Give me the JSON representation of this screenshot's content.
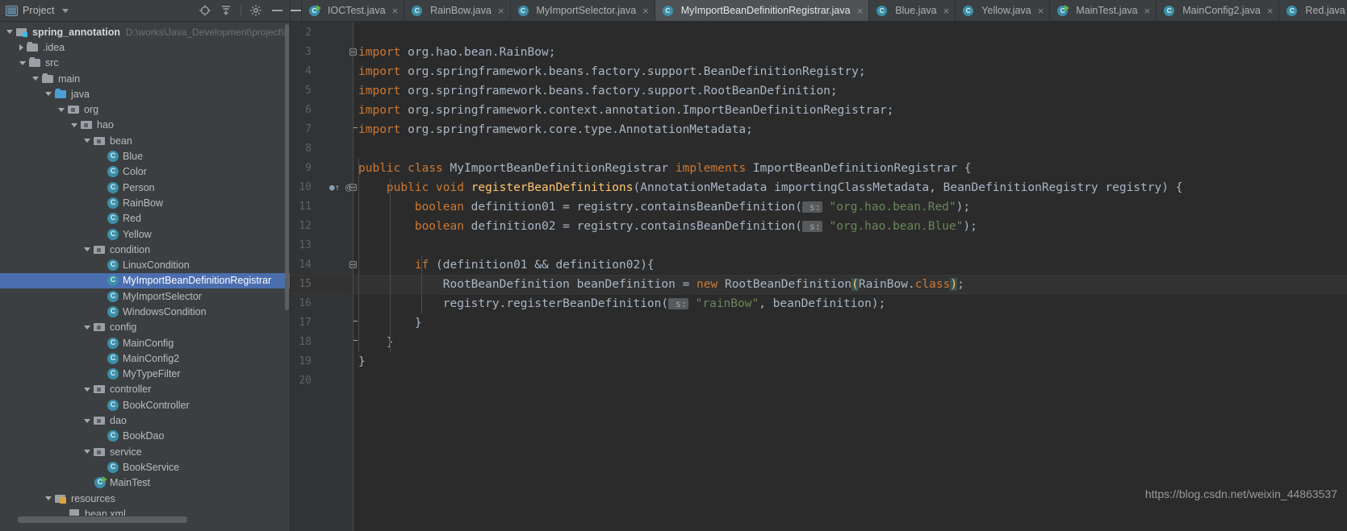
{
  "sidebar": {
    "title": "Project",
    "title_icon": "project-window-icon",
    "caret_icon": "chevron-down-icon",
    "actions": [
      {
        "name": "locate-icon",
        "label": "Select Opened File"
      },
      {
        "name": "collapse-all-icon",
        "label": "Collapse All"
      },
      {
        "name": "gear-icon",
        "label": "Settings"
      },
      {
        "name": "minimize-icon",
        "label": "Hide"
      }
    ],
    "tree": [
      {
        "depth": 0,
        "arrow": "down",
        "icon": "project-folder-icon",
        "label": "spring_annotation",
        "bold": true,
        "path": "D:\\works\\Java_Development\\project\\I",
        "selected": false
      },
      {
        "depth": 1,
        "arrow": "right",
        "icon": "folder-icon",
        "label": ".idea",
        "bold": false,
        "path": "",
        "selected": false
      },
      {
        "depth": 1,
        "arrow": "down",
        "icon": "folder-icon",
        "label": "src",
        "bold": false,
        "path": "",
        "selected": false
      },
      {
        "depth": 2,
        "arrow": "down",
        "icon": "folder-icon",
        "label": "main",
        "bold": false,
        "path": "",
        "selected": false
      },
      {
        "depth": 3,
        "arrow": "down",
        "icon": "source-folder-icon",
        "label": "java",
        "bold": false,
        "path": "",
        "selected": false
      },
      {
        "depth": 4,
        "arrow": "down",
        "icon": "package-icon",
        "label": "org",
        "bold": false,
        "path": "",
        "selected": false
      },
      {
        "depth": 5,
        "arrow": "down",
        "icon": "package-icon",
        "label": "hao",
        "bold": false,
        "path": "",
        "selected": false
      },
      {
        "depth": 6,
        "arrow": "down",
        "icon": "package-icon",
        "label": "bean",
        "bold": false,
        "path": "",
        "selected": false
      },
      {
        "depth": 7,
        "arrow": "none",
        "icon": "class-icon",
        "label": "Blue",
        "bold": false,
        "path": "",
        "selected": false
      },
      {
        "depth": 7,
        "arrow": "none",
        "icon": "class-icon",
        "label": "Color",
        "bold": false,
        "path": "",
        "selected": false
      },
      {
        "depth": 7,
        "arrow": "none",
        "icon": "class-icon",
        "label": "Person",
        "bold": false,
        "path": "",
        "selected": false
      },
      {
        "depth": 7,
        "arrow": "none",
        "icon": "class-icon",
        "label": "RainBow",
        "bold": false,
        "path": "",
        "selected": false
      },
      {
        "depth": 7,
        "arrow": "none",
        "icon": "class-icon",
        "label": "Red",
        "bold": false,
        "path": "",
        "selected": false
      },
      {
        "depth": 7,
        "arrow": "none",
        "icon": "class-icon",
        "label": "Yellow",
        "bold": false,
        "path": "",
        "selected": false
      },
      {
        "depth": 6,
        "arrow": "down",
        "icon": "package-icon",
        "label": "condition",
        "bold": false,
        "path": "",
        "selected": false
      },
      {
        "depth": 7,
        "arrow": "none",
        "icon": "class-icon",
        "label": "LinuxCondition",
        "bold": false,
        "path": "",
        "selected": false
      },
      {
        "depth": 7,
        "arrow": "none",
        "icon": "class-icon",
        "label": "MyImportBeanDefinitionRegistrar",
        "bold": false,
        "path": "",
        "selected": true
      },
      {
        "depth": 7,
        "arrow": "none",
        "icon": "class-icon",
        "label": "MyImportSelector",
        "bold": false,
        "path": "",
        "selected": false
      },
      {
        "depth": 7,
        "arrow": "none",
        "icon": "class-icon",
        "label": "WindowsCondition",
        "bold": false,
        "path": "",
        "selected": false
      },
      {
        "depth": 6,
        "arrow": "down",
        "icon": "package-icon",
        "label": "config",
        "bold": false,
        "path": "",
        "selected": false
      },
      {
        "depth": 7,
        "arrow": "none",
        "icon": "class-icon",
        "label": "MainConfig",
        "bold": false,
        "path": "",
        "selected": false
      },
      {
        "depth": 7,
        "arrow": "none",
        "icon": "class-icon",
        "label": "MainConfig2",
        "bold": false,
        "path": "",
        "selected": false
      },
      {
        "depth": 7,
        "arrow": "none",
        "icon": "class-icon",
        "label": "MyTypeFilter",
        "bold": false,
        "path": "",
        "selected": false
      },
      {
        "depth": 6,
        "arrow": "down",
        "icon": "package-icon",
        "label": "controller",
        "bold": false,
        "path": "",
        "selected": false
      },
      {
        "depth": 7,
        "arrow": "none",
        "icon": "class-icon",
        "label": "BookController",
        "bold": false,
        "path": "",
        "selected": false
      },
      {
        "depth": 6,
        "arrow": "down",
        "icon": "package-icon",
        "label": "dao",
        "bold": false,
        "path": "",
        "selected": false
      },
      {
        "depth": 7,
        "arrow": "none",
        "icon": "class-icon",
        "label": "BookDao",
        "bold": false,
        "path": "",
        "selected": false
      },
      {
        "depth": 6,
        "arrow": "down",
        "icon": "package-icon",
        "label": "service",
        "bold": false,
        "path": "",
        "selected": false
      },
      {
        "depth": 7,
        "arrow": "none",
        "icon": "class-icon",
        "label": "BookService",
        "bold": false,
        "path": "",
        "selected": false
      },
      {
        "depth": 6,
        "arrow": "none",
        "icon": "runnable-class-icon",
        "label": "MainTest",
        "bold": false,
        "path": "",
        "selected": false
      },
      {
        "depth": 3,
        "arrow": "down",
        "icon": "resources-folder-icon",
        "label": "resources",
        "bold": false,
        "path": "",
        "selected": false
      },
      {
        "depth": 4,
        "arrow": "none",
        "icon": "xml-file-icon",
        "label": "bean.xml",
        "bold": false,
        "path": "",
        "selected": false
      }
    ]
  },
  "tabs": {
    "hide_button": "minimize-icon",
    "close_glyph": "×",
    "items": [
      {
        "label": "IOCTest.java",
        "icon": "runnable-class-icon",
        "active": false,
        "closable": true
      },
      {
        "label": "RainBow.java",
        "icon": "class-icon",
        "active": false,
        "closable": true
      },
      {
        "label": "MyImportSelector.java",
        "icon": "class-icon",
        "active": false,
        "closable": true
      },
      {
        "label": "MyImportBeanDefinitionRegistrar.java",
        "icon": "class-icon",
        "active": true,
        "closable": true
      },
      {
        "label": "Blue.java",
        "icon": "class-icon",
        "active": false,
        "closable": true
      },
      {
        "label": "Yellow.java",
        "icon": "class-icon",
        "active": false,
        "closable": true
      },
      {
        "label": "MainTest.java",
        "icon": "runnable-class-icon",
        "active": false,
        "closable": true
      },
      {
        "label": "MainConfig2.java",
        "icon": "class-icon",
        "active": false,
        "closable": true
      },
      {
        "label": "Red.java",
        "icon": "class-icon",
        "active": false,
        "closable": true
      }
    ]
  },
  "editor": {
    "first_line_number": 2,
    "current_line": 15,
    "gutter_marks": {
      "line10": "●↑ @"
    },
    "lines": [
      {
        "n": 2,
        "segments": [
          {
            "t": "",
            "c": "txt"
          }
        ]
      },
      {
        "n": 3,
        "fold": "start",
        "segments": [
          {
            "t": "import",
            "c": "kw"
          },
          {
            "t": " org.hao.bean.RainBow;",
            "c": "txt"
          }
        ]
      },
      {
        "n": 4,
        "segments": [
          {
            "t": "import",
            "c": "kw"
          },
          {
            "t": " org.springframework.beans.factory.support.BeanDefinitionRegistry;",
            "c": "txt"
          }
        ]
      },
      {
        "n": 5,
        "segments": [
          {
            "t": "import",
            "c": "kw"
          },
          {
            "t": " org.springframework.beans.factory.support.RootBeanDefinition;",
            "c": "txt"
          }
        ]
      },
      {
        "n": 6,
        "segments": [
          {
            "t": "import",
            "c": "kw"
          },
          {
            "t": " org.springframework.context.annotation.ImportBeanDefinitionRegistrar;",
            "c": "txt"
          }
        ]
      },
      {
        "n": 7,
        "fold": "end",
        "segments": [
          {
            "t": "import",
            "c": "kw"
          },
          {
            "t": " org.springframework.core.type.AnnotationMetadata;",
            "c": "txt"
          }
        ]
      },
      {
        "n": 8,
        "segments": [
          {
            "t": "",
            "c": "txt"
          }
        ]
      },
      {
        "n": 9,
        "segments": [
          {
            "t": "public",
            "c": "kw"
          },
          {
            "t": " ",
            "c": "txt"
          },
          {
            "t": "class",
            "c": "kw"
          },
          {
            "t": " MyImportBeanDefinitionRegistrar ",
            "c": "txt"
          },
          {
            "t": "implements",
            "c": "kw"
          },
          {
            "t": " ImportBeanDefinitionRegistrar {",
            "c": "txt"
          }
        ]
      },
      {
        "n": 10,
        "fold": "start",
        "indent": 1,
        "segments": [
          {
            "t": "    ",
            "c": "txt"
          },
          {
            "t": "public",
            "c": "kw"
          },
          {
            "t": " ",
            "c": "txt"
          },
          {
            "t": "void",
            "c": "kw"
          },
          {
            "t": " ",
            "c": "txt"
          },
          {
            "t": "registerBeanDefinitions",
            "c": "mth"
          },
          {
            "t": "(AnnotationMetadata importingClassMetadata, BeanDefinitionRegistry registry) {",
            "c": "txt"
          }
        ]
      },
      {
        "n": 11,
        "indent": 2,
        "segments": [
          {
            "t": "        ",
            "c": "txt"
          },
          {
            "t": "boolean",
            "c": "kw"
          },
          {
            "t": " definition01 = registry.containsBeanDefinition(",
            "c": "txt"
          },
          {
            "t": " s:",
            "c": "hint"
          },
          {
            "t": " ",
            "c": "txt"
          },
          {
            "t": "\"org.hao.bean.Red\"",
            "c": "str"
          },
          {
            "t": ");",
            "c": "txt"
          }
        ]
      },
      {
        "n": 12,
        "indent": 2,
        "segments": [
          {
            "t": "        ",
            "c": "txt"
          },
          {
            "t": "boolean",
            "c": "kw"
          },
          {
            "t": " definition02 = registry.containsBeanDefinition(",
            "c": "txt"
          },
          {
            "t": " s:",
            "c": "hint"
          },
          {
            "t": " ",
            "c": "txt"
          },
          {
            "t": "\"org.hao.bean.Blue\"",
            "c": "str"
          },
          {
            "t": ");",
            "c": "txt"
          }
        ]
      },
      {
        "n": 13,
        "segments": [
          {
            "t": "",
            "c": "txt"
          }
        ]
      },
      {
        "n": 14,
        "fold": "start",
        "indent": 2,
        "segments": [
          {
            "t": "        ",
            "c": "txt"
          },
          {
            "t": "if",
            "c": "kw"
          },
          {
            "t": " (definition01 && definition02){",
            "c": "txt"
          }
        ]
      },
      {
        "n": 15,
        "indent": 3,
        "segments": [
          {
            "t": "            RootBeanDefinition beanDefinition = ",
            "c": "txt"
          },
          {
            "t": "new",
            "c": "kw"
          },
          {
            "t": " RootBeanDefinition",
            "c": "txt"
          },
          {
            "t": "(",
            "c": "brkhl"
          },
          {
            "t": "RainBow.",
            "c": "txt"
          },
          {
            "t": "class",
            "c": "kw"
          },
          {
            "t": ")",
            "c": "brkhl"
          },
          {
            "t": ";",
            "c": "txt"
          }
        ]
      },
      {
        "n": 16,
        "indent": 3,
        "segments": [
          {
            "t": "            registry.registerBeanDefinition(",
            "c": "txt"
          },
          {
            "t": " s:",
            "c": "hint"
          },
          {
            "t": " ",
            "c": "txt"
          },
          {
            "t": "\"rainBow\"",
            "c": "str"
          },
          {
            "t": ", beanDefinition);",
            "c": "txt"
          }
        ]
      },
      {
        "n": 17,
        "fold": "end",
        "indent": 2,
        "segments": [
          {
            "t": "        }",
            "c": "txt"
          }
        ]
      },
      {
        "n": 18,
        "fold": "end",
        "indent": 1,
        "segments": [
          {
            "t": "    }",
            "c": "txt"
          }
        ]
      },
      {
        "n": 19,
        "segments": [
          {
            "t": "}",
            "c": "txt"
          }
        ]
      },
      {
        "n": 20,
        "segments": [
          {
            "t": "",
            "c": "txt"
          }
        ]
      }
    ]
  },
  "watermark": "https://blog.csdn.net/weixin_44863537",
  "colors": {
    "sidebar_bg": "#3c3f41",
    "editor_bg": "#2b2b2b",
    "gutter_bg": "#313335",
    "selection_blue": "#4b6eaf",
    "active_tab_bg": "#4e5254",
    "keyword_orange": "#cc7832",
    "string_green": "#6a8759",
    "method_yellow": "#ffc66d",
    "text_gray": "#a9b7c6",
    "class_icon_teal": "#3b8fa8"
  }
}
